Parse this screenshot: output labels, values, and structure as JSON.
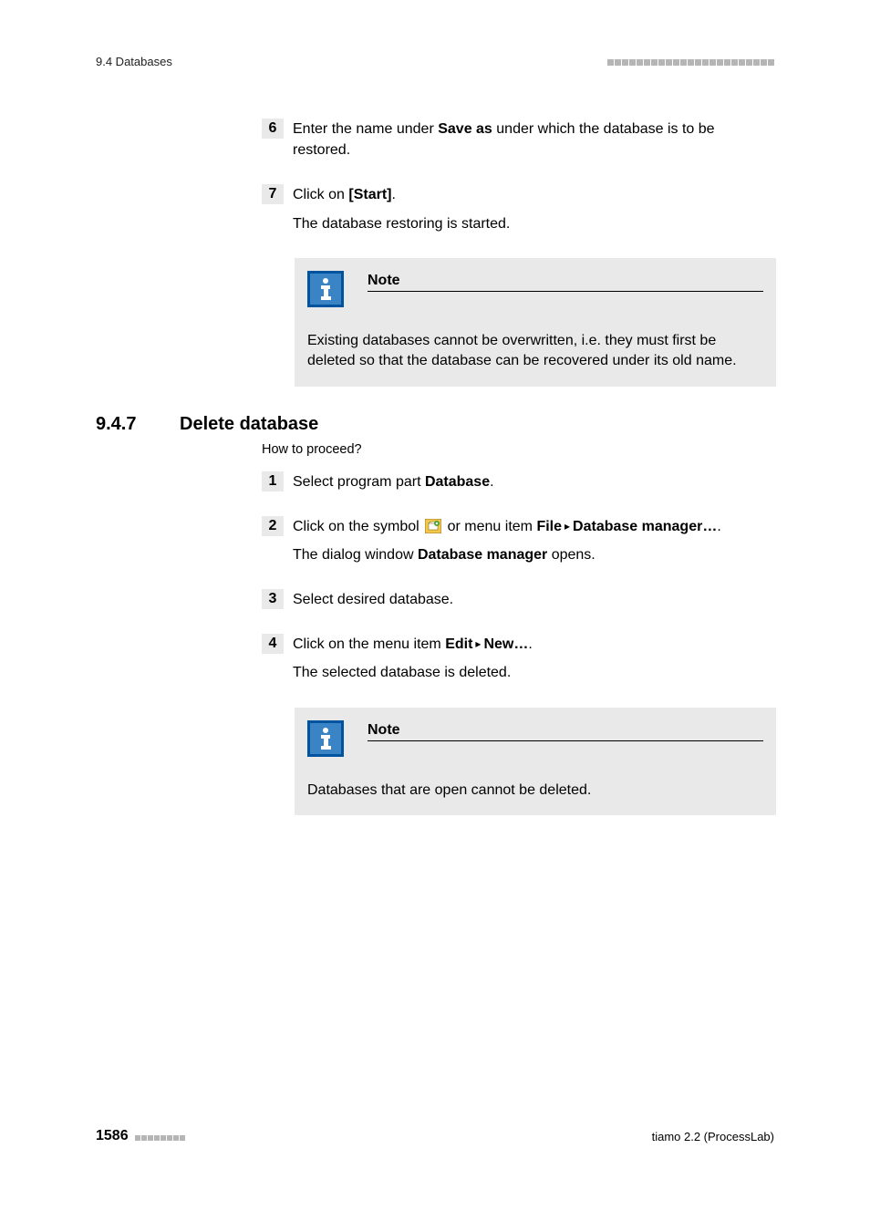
{
  "header": {
    "breadcrumb": "9.4 Databases"
  },
  "top_steps": [
    {
      "num": "6",
      "parts": [
        "Enter the name under ",
        "Save as",
        " under which the database is to be restored."
      ]
    },
    {
      "num": "7",
      "parts": [
        "Click on ",
        "[Start]",
        "."
      ],
      "sub": "The database restoring is started."
    }
  ],
  "note1": {
    "title": "Note",
    "body": "Existing databases cannot be overwritten, i.e. they must first be deleted so that the database can be recovered under its old name."
  },
  "section": {
    "num": "9.4.7",
    "title": "Delete database",
    "sub": "How to proceed?"
  },
  "del_steps": {
    "s1": {
      "num": "1",
      "a": "Select program part ",
      "b": "Database",
      "c": "."
    },
    "s2": {
      "num": "2",
      "a": "Click on the symbol ",
      "b": " or menu item ",
      "c": "File",
      "d": "Database manager…",
      "e": ".",
      "sub_a": "The dialog window ",
      "sub_b": "Database manager",
      "sub_c": " opens."
    },
    "s3": {
      "num": "3",
      "a": "Select desired database."
    },
    "s4": {
      "num": "4",
      "a": "Click on the menu item ",
      "b": "Edit",
      "c": "New…",
      "d": ".",
      "sub": "The selected database is deleted."
    }
  },
  "note2": {
    "title": "Note",
    "body": "Databases that are open cannot be deleted."
  },
  "footer": {
    "page": "1586",
    "right": "tiamo 2.2 (ProcessLab)"
  },
  "menu_arrow": "▸"
}
